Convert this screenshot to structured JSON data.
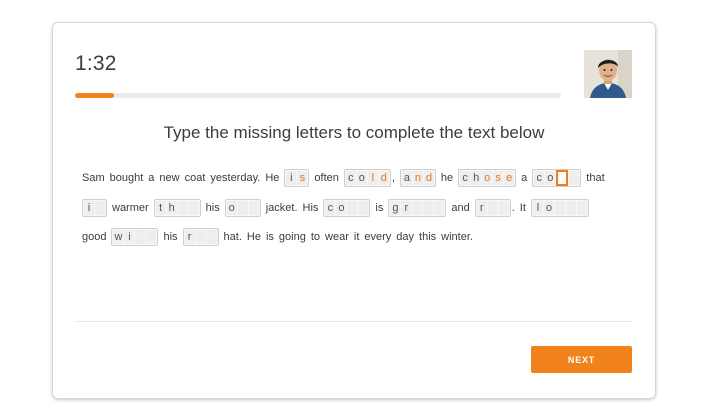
{
  "timer": "1:32",
  "progress": {
    "fraction": 0.08,
    "color": "#f2831c"
  },
  "avatar": {
    "alt": "proctor-avatar"
  },
  "instruction": "Type the missing letters to complete the text below",
  "passage": {
    "lines": [
      [
        {
          "t": "w",
          "v": "Sam"
        },
        {
          "t": "w",
          "v": "bought"
        },
        {
          "t": "w",
          "v": "a"
        },
        {
          "t": "w",
          "v": "new"
        },
        {
          "t": "w",
          "v": "coat"
        },
        {
          "t": "w",
          "v": "yesterday."
        },
        {
          "t": "w",
          "v": "He"
        },
        {
          "t": "b",
          "cells": [
            {
              "c": "i",
              "s": "given"
            },
            {
              "c": "s",
              "s": "typed"
            }
          ]
        },
        {
          "t": "w",
          "v": "often"
        },
        {
          "t": "b",
          "cells": [
            {
              "c": "c",
              "s": "given"
            },
            {
              "c": "o",
              "s": "given"
            },
            {
              "c": "l",
              "s": "typed"
            },
            {
              "c": "d",
              "s": "typed"
            }
          ],
          "after": ","
        },
        {
          "t": "b",
          "cells": [
            {
              "c": "a",
              "s": "given"
            },
            {
              "c": "n",
              "s": "typed"
            },
            {
              "c": "d",
              "s": "typed"
            }
          ]
        },
        {
          "t": "w",
          "v": "he"
        },
        {
          "t": "b",
          "cells": [
            {
              "c": "c",
              "s": "given"
            },
            {
              "c": "h",
              "s": "given"
            },
            {
              "c": "o",
              "s": "typed"
            },
            {
              "c": "s",
              "s": "typed"
            },
            {
              "c": "e",
              "s": "typed"
            }
          ]
        },
        {
          "t": "w",
          "v": "a"
        },
        {
          "t": "b",
          "cells": [
            {
              "c": "c",
              "s": "given"
            },
            {
              "c": "o",
              "s": "given"
            },
            {
              "c": "",
              "s": "cursor"
            },
            {
              "c": "",
              "s": "empty"
            }
          ]
        },
        {
          "t": "w",
          "v": "that"
        }
      ],
      [
        {
          "t": "b",
          "cells": [
            {
              "c": "i",
              "s": "given"
            },
            {
              "c": "",
              "s": "empty"
            }
          ]
        },
        {
          "t": "w",
          "v": "warmer"
        },
        {
          "t": "b",
          "cells": [
            {
              "c": "t",
              "s": "given"
            },
            {
              "c": "h",
              "s": "given"
            },
            {
              "c": "",
              "s": "empty"
            },
            {
              "c": "",
              "s": "empty"
            }
          ]
        },
        {
          "t": "w",
          "v": "his"
        },
        {
          "t": "b",
          "cells": [
            {
              "c": "o",
              "s": "given"
            },
            {
              "c": "",
              "s": "empty"
            },
            {
              "c": "",
              "s": "empty"
            }
          ]
        },
        {
          "t": "w",
          "v": "jacket."
        },
        {
          "t": "w",
          "v": "His"
        },
        {
          "t": "b",
          "cells": [
            {
              "c": "c",
              "s": "given"
            },
            {
              "c": "o",
              "s": "given"
            },
            {
              "c": "",
              "s": "empty"
            },
            {
              "c": "",
              "s": "empty"
            }
          ]
        },
        {
          "t": "w",
          "v": "is"
        },
        {
          "t": "b",
          "cells": [
            {
              "c": "g",
              "s": "given"
            },
            {
              "c": "r",
              "s": "given"
            },
            {
              "c": "",
              "s": "empty"
            },
            {
              "c": "",
              "s": "empty"
            },
            {
              "c": "",
              "s": "empty"
            }
          ]
        },
        {
          "t": "w",
          "v": "and"
        },
        {
          "t": "b",
          "cells": [
            {
              "c": "r",
              "s": "given"
            },
            {
              "c": "",
              "s": "empty"
            },
            {
              "c": "",
              "s": "empty"
            }
          ],
          "after": "."
        },
        {
          "t": "w",
          "v": "It"
        },
        {
          "t": "b",
          "cells": [
            {
              "c": "l",
              "s": "given"
            },
            {
              "c": "o",
              "s": "given"
            },
            {
              "c": "",
              "s": "empty"
            },
            {
              "c": "",
              "s": "empty"
            },
            {
              "c": "",
              "s": "empty"
            }
          ]
        }
      ],
      [
        {
          "t": "w",
          "v": "good"
        },
        {
          "t": "b",
          "cells": [
            {
              "c": "w",
              "s": "given"
            },
            {
              "c": "i",
              "s": "given"
            },
            {
              "c": "",
              "s": "empty"
            },
            {
              "c": "",
              "s": "empty"
            }
          ]
        },
        {
          "t": "w",
          "v": "his"
        },
        {
          "t": "b",
          "cells": [
            {
              "c": "r",
              "s": "given"
            },
            {
              "c": "",
              "s": "empty"
            },
            {
              "c": "",
              "s": "empty"
            }
          ]
        },
        {
          "t": "w",
          "v": "hat."
        },
        {
          "t": "w",
          "v": "He"
        },
        {
          "t": "w",
          "v": "is"
        },
        {
          "t": "w",
          "v": "going"
        },
        {
          "t": "w",
          "v": "to"
        },
        {
          "t": "w",
          "v": "wear"
        },
        {
          "t": "w",
          "v": "it"
        },
        {
          "t": "w",
          "v": "every"
        },
        {
          "t": "w",
          "v": "day"
        },
        {
          "t": "w",
          "v": "this"
        },
        {
          "t": "w",
          "v": "winter."
        }
      ]
    ]
  },
  "next_button": "NEXT",
  "colors": {
    "accent": "#f2831c",
    "typed_letter": "#e8771c"
  }
}
